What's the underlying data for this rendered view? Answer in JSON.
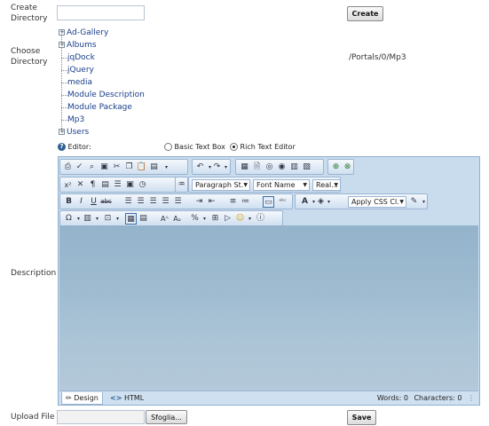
{
  "create_directory": {
    "label": "Create Directory",
    "input_value": "",
    "button": "Create"
  },
  "choose_directory": {
    "label": "Choose Directory",
    "current_path": "/Portals/0/Mp3",
    "tree": [
      {
        "label": "Ad-Gallery",
        "expandable": true
      },
      {
        "label": "Albums",
        "expandable": true
      },
      {
        "label": "jqDock",
        "expandable": false
      },
      {
        "label": "jQuery",
        "expandable": false
      },
      {
        "label": "media",
        "expandable": false
      },
      {
        "label": "Module Description",
        "expandable": false
      },
      {
        "label": "Module Package",
        "expandable": false
      },
      {
        "label": "Mp3",
        "expandable": false
      },
      {
        "label": "Users",
        "expandable": true
      }
    ]
  },
  "editor_mode": {
    "help_label": "Editor:",
    "options": [
      {
        "label": "Basic Text Box",
        "selected": false
      },
      {
        "label": "Rich Text Editor",
        "selected": true
      }
    ]
  },
  "description": {
    "label": "Description",
    "toolbar": {
      "paragraph_style": "Paragraph St.",
      "font_name": "Font Name",
      "font_size": "Real...",
      "css_class": "Apply CSS Cl."
    },
    "tabs": [
      {
        "label": "Design",
        "active": true
      },
      {
        "label": "HTML",
        "active": false
      }
    ],
    "words": "Words: 0",
    "characters": "Characters: 0"
  },
  "upload": {
    "label": "Upload File",
    "browse_button": "Sfoglia...",
    "save_button": "Save"
  },
  "colors": {
    "editor_bg": "#c9dcee",
    "content_bg": "#9dbacf",
    "link": "#1a3e8c"
  }
}
